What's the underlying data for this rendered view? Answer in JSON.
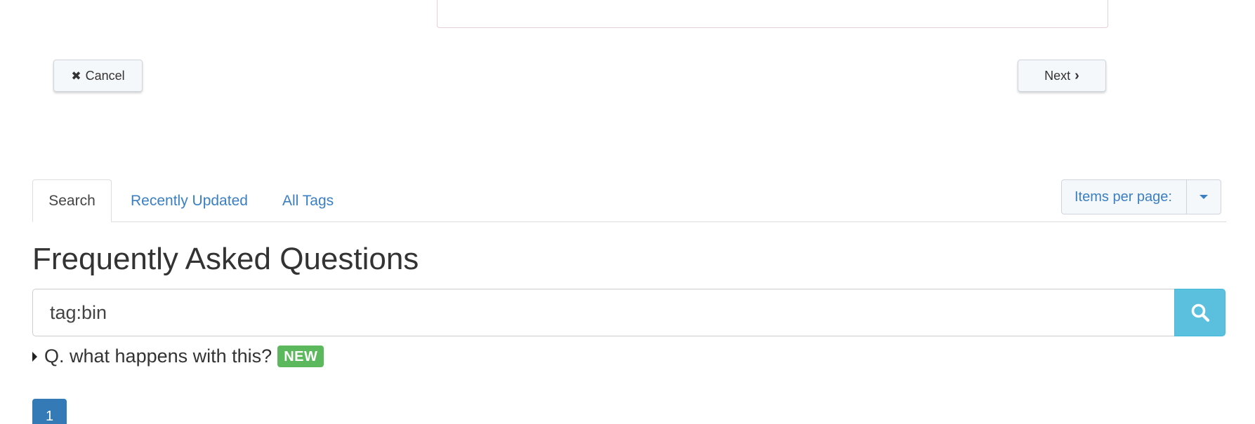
{
  "wizard": {
    "cancel_label": "Cancel",
    "cancel_icon": "close-icon",
    "next_label": "Next",
    "next_icon": "chevron-right-icon"
  },
  "tabs": [
    {
      "label": "Search",
      "active": true
    },
    {
      "label": "Recently Updated",
      "active": false
    },
    {
      "label": "All Tags",
      "active": false
    }
  ],
  "items_per_page": {
    "label": "Items per page:",
    "icon": "caret-down-icon"
  },
  "faq": {
    "title": "Frequently Asked Questions",
    "search_value": "tag:bin",
    "search_icon": "search-icon",
    "items": [
      {
        "question": "Q. what happens with this?",
        "badge": "NEW"
      }
    ]
  },
  "pagination": {
    "pages": [
      "1"
    ],
    "current": "1"
  },
  "colors": {
    "link": "#3a7fc4",
    "search_button": "#5bc0de",
    "badge_new": "#5cb85c",
    "pagination_active": "#337ab7"
  }
}
